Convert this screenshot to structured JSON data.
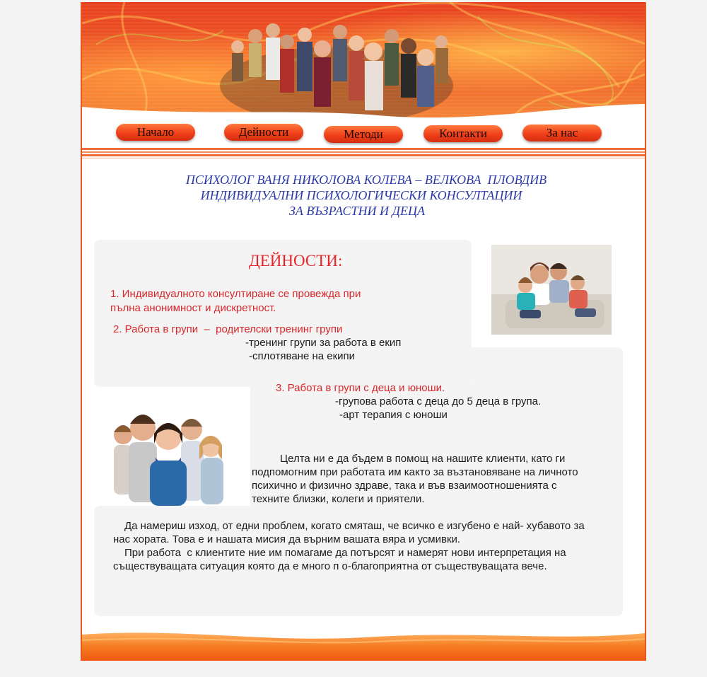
{
  "nav": [
    {
      "label": "Начало"
    },
    {
      "label": "Дейности"
    },
    {
      "label": "Методи"
    },
    {
      "label": "Контакти"
    },
    {
      "label": "За нас"
    }
  ],
  "header": {
    "line1": "ПСИХОЛОГ ВАНЯ НИКОЛОВА КОЛЕВА – ВЕЛКОВА  ПЛОВДИВ",
    "line2": "ИНДИВИДУАЛНИ ПСИХОЛОГИЧЕСКИ КОНСУЛТАЦИИ",
    "line3": "ЗА ВЪЗРАСТНИ И ДЕЦА"
  },
  "activities": {
    "title": "ДЕЙНОСТИ:",
    "item1_line1": "1. Индивидуалното консултиране се провежда при",
    "item1_line2": "пълна анонимност и дискретност.",
    "item2_line1": "2. Работа в групи  –  родителски тренинг групи",
    "item2_sub1": "-тренинг групи за работа в екип",
    "item2_sub2": "-сплотяване на екипи",
    "item3_line1": "3. Работа в групи с деца и юноши.",
    "item3_sub1": "-групова работа с деца до 5 деца в група.",
    "item3_sub2": "-арт терапия с юноши"
  },
  "mission": {
    "p1_line1": "Целта ни е да бъдем в помощ на нашите клиенти, като ги",
    "p1_line2": "подпомогним при работата им както за възтановяване на личното",
    "p1_line3": "психично и физично здраве, така и във взаимоотношенията с",
    "p1_line4": "техните близки, колеги и приятели.",
    "p2_line1": "Да намериш изход, от едни проблем, когато смяташ, че всичко е изгубено е най- хубавото за",
    "p2_line2": "нас хората. Това е и нашата мисия да върним вашата вяра и усмивки.",
    "p3_line1": "При работа  с клиентите ние им помагаме да потърсят и намерят нови интерпретация на",
    "p3_line2": "съществуващата ситуация която да е много п о-благоприятна от съществуващата вече."
  },
  "colors": {
    "accent": "#e8561f",
    "heading_blue": "#2b3aa8",
    "item_red": "#d9262a",
    "panel_bg": "#f4f4f4"
  },
  "images": {
    "banner": "crowd-of-people-photo",
    "family": "family-on-sofa-photo",
    "teens": "group-of-teenagers-photo"
  }
}
